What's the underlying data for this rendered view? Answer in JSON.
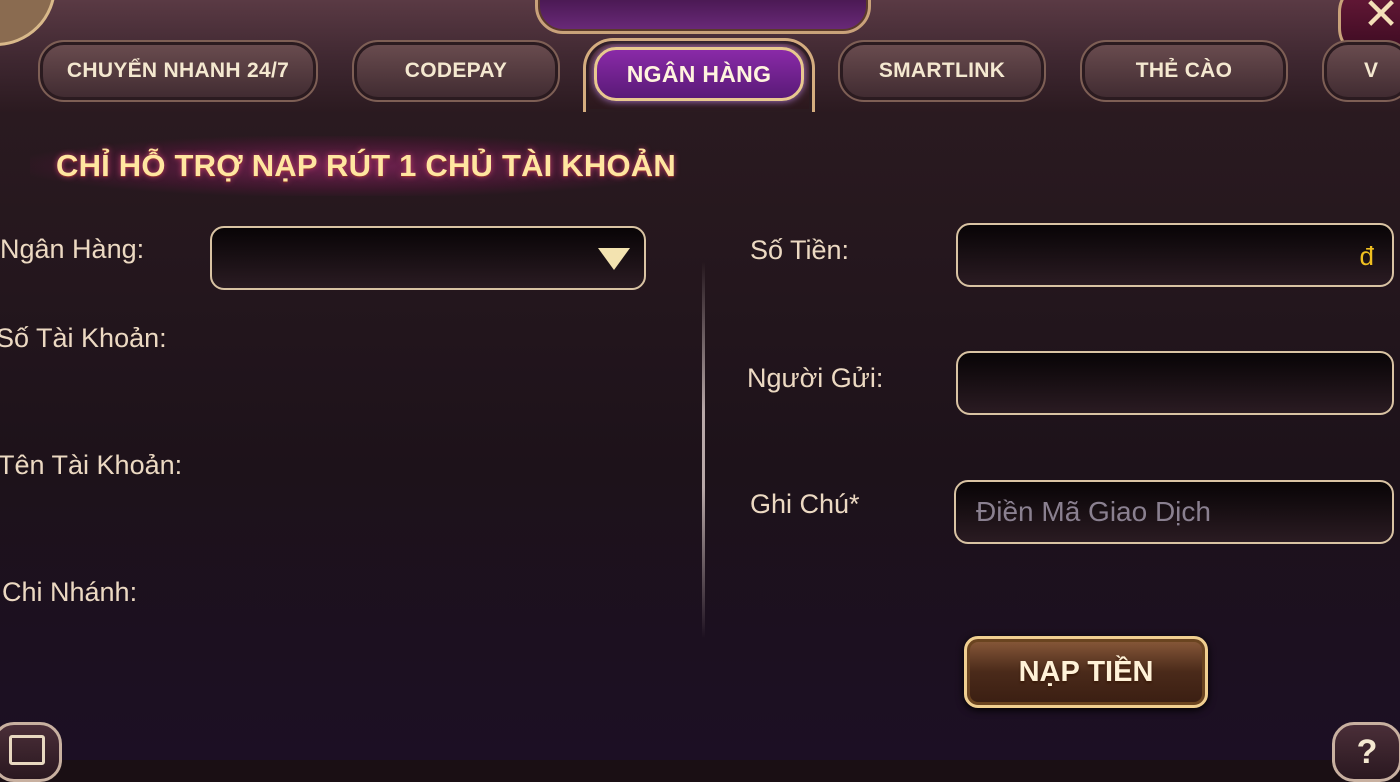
{
  "tabs": [
    {
      "label": "CHUYỂN NHANH 24/7"
    },
    {
      "label": "CODEPAY"
    },
    {
      "label": "NGÂN HÀNG"
    },
    {
      "label": "SMARTLINK"
    },
    {
      "label": "THẺ CÀO"
    },
    {
      "label": "V"
    }
  ],
  "active_tab": "NGÂN HÀNG",
  "notice": "CHỈ HỖ TRỢ NẠP RÚT 1 CHỦ TÀI KHOẢN",
  "left": {
    "bank_label": "Ngân Hàng:",
    "bank_value": "",
    "account_number_label": "Số Tài Khoản:",
    "account_name_label": "Tên Tài Khoản:",
    "branch_label": "Chi Nhánh:"
  },
  "right": {
    "amount_label": "Số Tiền:",
    "amount_value": "",
    "currency_symbol": "đ",
    "sender_label": "Người Gửi:",
    "sender_value": "",
    "note_label": "Ghi Chú*",
    "note_placeholder": "Điền Mã Giao Dịch"
  },
  "submit_label": "NẠP TIỀN",
  "close_glyph": "✕",
  "help_glyph": "?",
  "icons": [
    "dropdown-arrow-icon",
    "close-icon",
    "history-icon",
    "help-icon"
  ],
  "colors": {
    "accent": "#d4ad7f",
    "active_tab": "#7a2a98",
    "notice": "#ffe6a0",
    "currency": "#f0c020"
  }
}
